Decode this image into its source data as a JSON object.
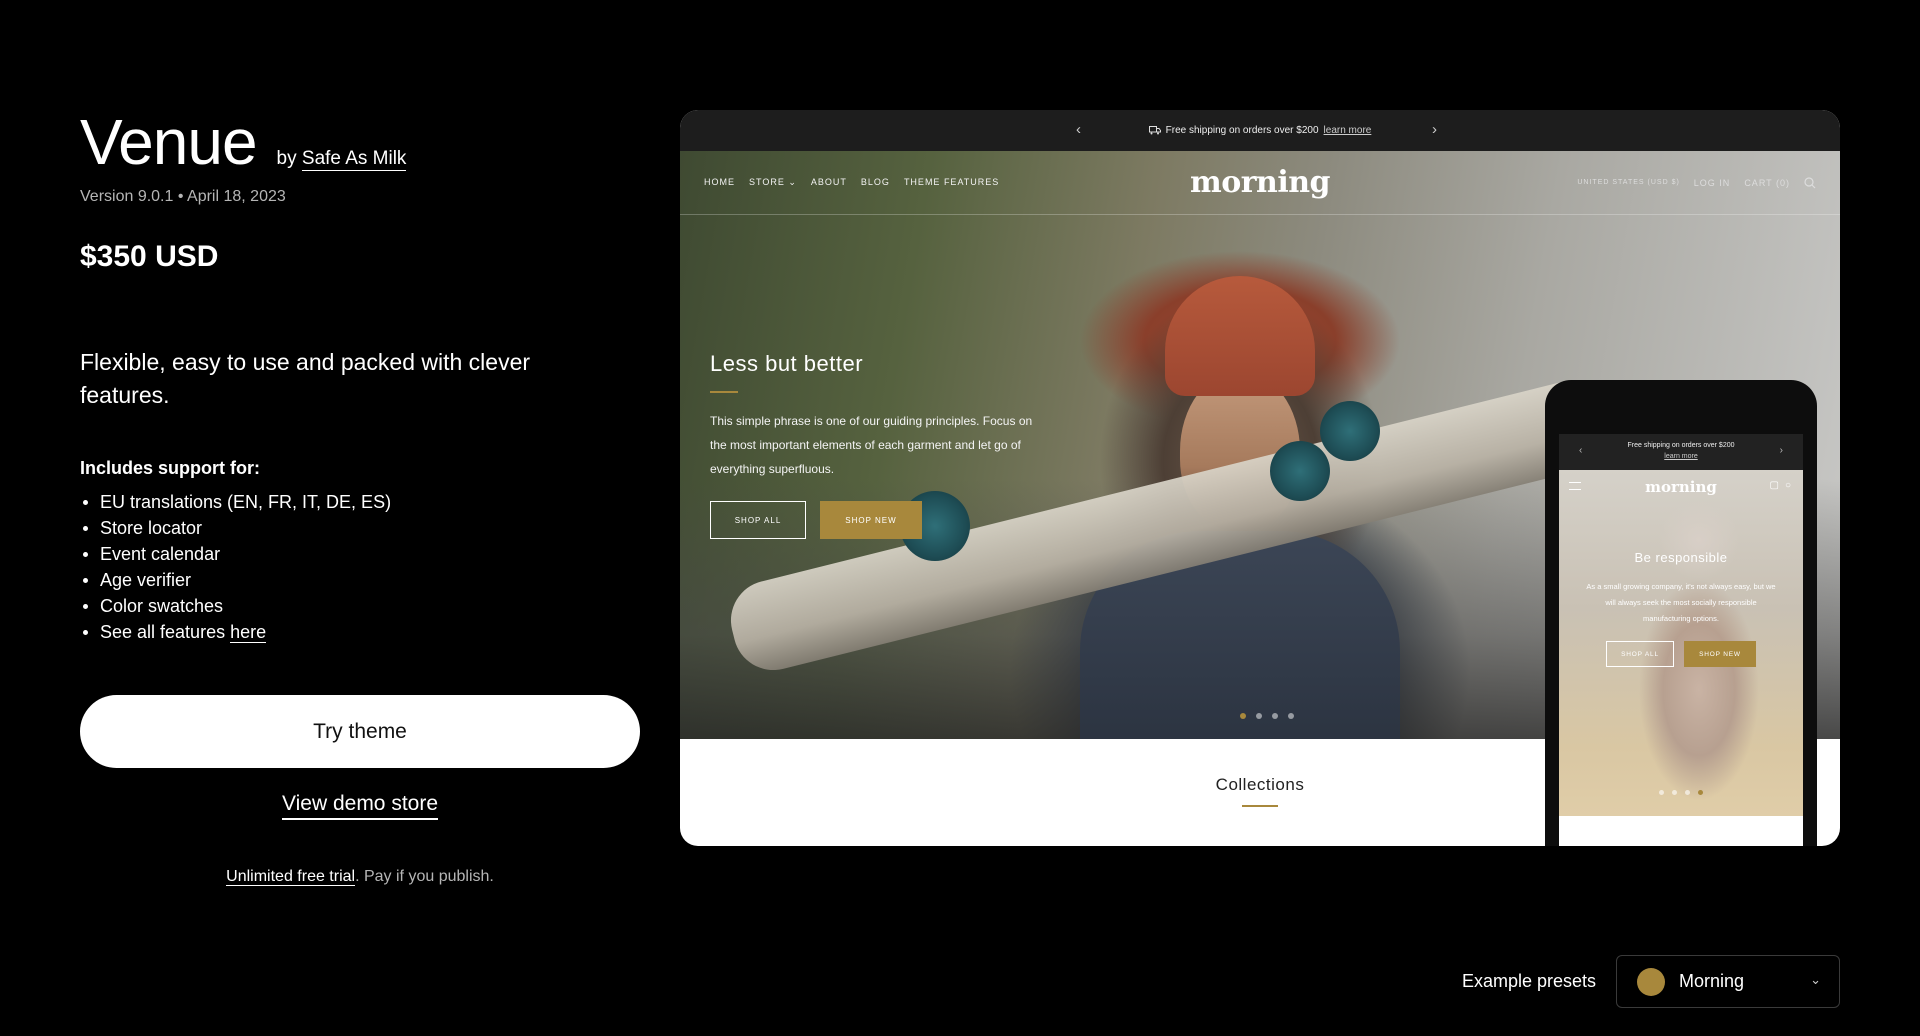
{
  "theme": {
    "name": "Venue",
    "by_prefix": "by",
    "author": "Safe As Milk",
    "version": "Version 9.0.1",
    "date_sep": "•",
    "date": "April 18, 2023",
    "price": "$350 USD",
    "tagline": "Flexible, easy to use and packed with clever features.",
    "includes_heading": "Includes support for:",
    "features": [
      "EU translations (EN, FR, IT, DE, ES)",
      "Store locator",
      "Event calendar",
      "Age verifier",
      "Color swatches"
    ],
    "features_more_prefix": "See all features",
    "features_more_link": "here",
    "try_button": "Try theme",
    "demo_link": "View demo store",
    "trial_link": "Unlimited free trial",
    "trial_suffix": ". Pay if you publish."
  },
  "preview": {
    "announcement": "Free shipping on orders over $200",
    "announcement_link": "learn more",
    "nav": [
      "HOME",
      "STORE",
      "ABOUT",
      "BLOG",
      "THEME FEATURES"
    ],
    "logo": "morning",
    "region": "UNITED STATES (USD $)",
    "login": "LOG IN",
    "cart": "CART (0)",
    "hero_title": "Less but better",
    "hero_text": "This simple phrase is one of our guiding principles. Focus on the most important elements of each garment and let go of everything superfluous.",
    "shop_all": "SHOP ALL",
    "shop_new": "SHOP NEW",
    "collections": "Collections"
  },
  "phone": {
    "announcement": "Free shipping on orders over $200",
    "announcement_link": "learn more",
    "logo": "morning",
    "hero_title": "Be responsible",
    "hero_text": "As a small growing company, it's not always easy, but we will always seek the most socially responsible manufacturing options.",
    "shop_all": "SHOP ALL",
    "shop_new": "SHOP NEW"
  },
  "presets": {
    "label": "Example presets",
    "selected": "Morning",
    "swatch_color": "#a8883c"
  },
  "colors": {
    "accent": "#a8883c",
    "background": "#000000"
  }
}
